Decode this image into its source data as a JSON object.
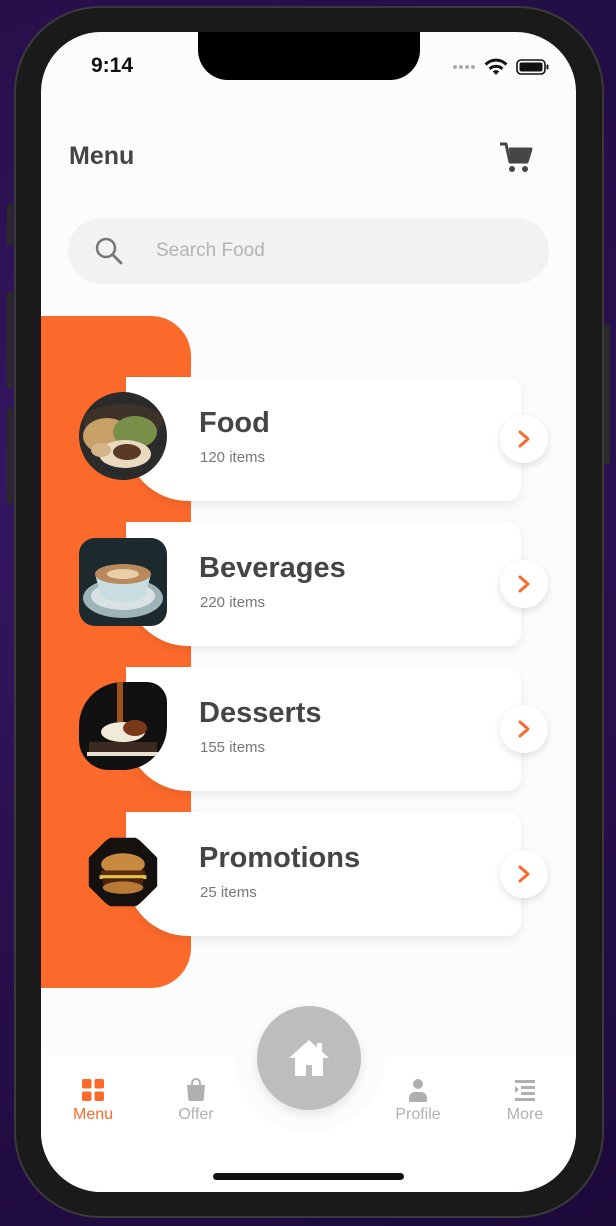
{
  "status": {
    "time": "9:14"
  },
  "header": {
    "title": "Menu",
    "cart_icon": "cart-icon"
  },
  "search": {
    "placeholder": "Search Food",
    "icon": "search-icon"
  },
  "colors": {
    "accent": "#fc6a2b",
    "text": "#454545",
    "muted": "#b0b0b0"
  },
  "categories": [
    {
      "name": "Food",
      "count": "120 items"
    },
    {
      "name": "Beverages",
      "count": "220 items"
    },
    {
      "name": "Desserts",
      "count": "155 items"
    },
    {
      "name": "Promotions",
      "count": "25 items"
    }
  ],
  "tabs": [
    {
      "label": "Menu",
      "icon": "grid-icon",
      "active": true
    },
    {
      "label": "Offer",
      "icon": "shopping-bag-icon",
      "active": false
    },
    {
      "label": "Profile",
      "icon": "person-icon",
      "active": false
    },
    {
      "label": "More",
      "icon": "list-icon",
      "active": false
    }
  ],
  "home_button": {
    "icon": "home-icon"
  }
}
